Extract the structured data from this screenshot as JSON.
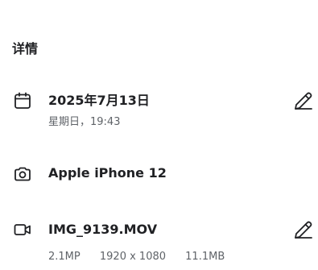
{
  "details": {
    "heading": "详情",
    "date": {
      "title": "2025年7月13日",
      "subtitle": "星期日，19:43",
      "icon": "calendar-icon",
      "edit_icon": "pencil-icon"
    },
    "camera": {
      "title": "Apple iPhone 12",
      "icon": "camera-icon"
    },
    "file": {
      "title": "IMG_9139.MOV",
      "icon": "video-icon",
      "edit_icon": "pencil-icon",
      "megapixels": "2.1MP",
      "resolution": "1920 x 1080",
      "size": "11.1MB"
    }
  }
}
